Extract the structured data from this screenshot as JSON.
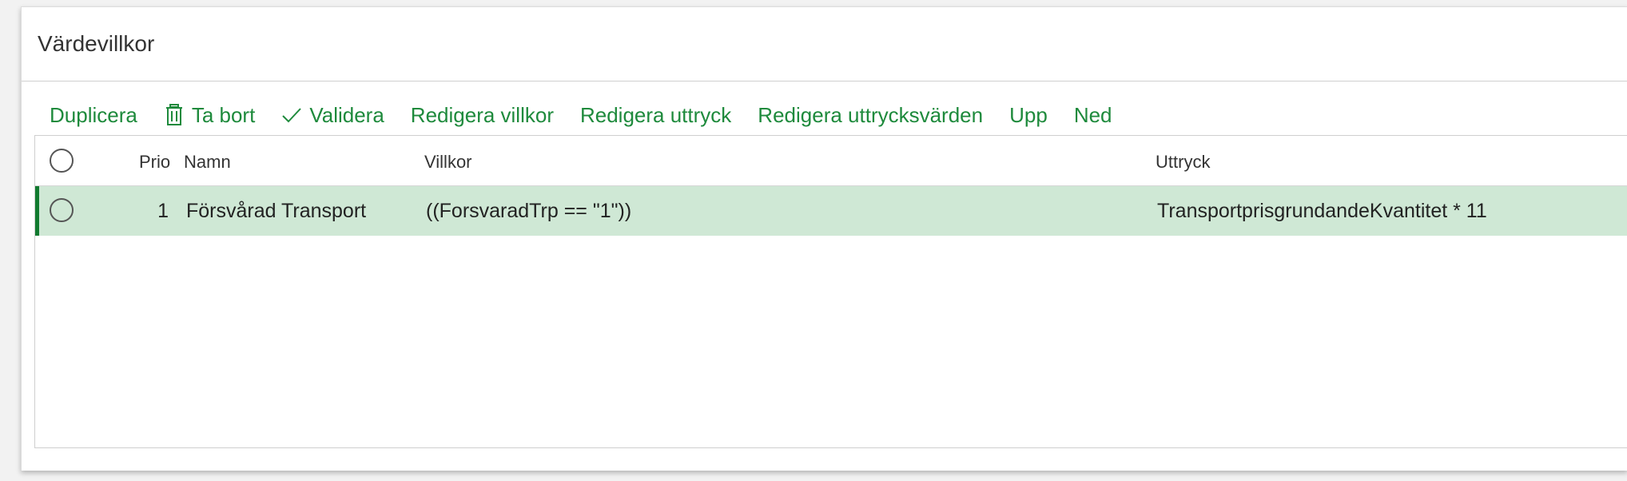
{
  "panel": {
    "title": "Värdevillkor"
  },
  "toolbar": {
    "duplicate": "Duplicera",
    "delete": "Ta bort",
    "validate": "Validera",
    "edit_conditions": "Redigera villkor",
    "edit_expression": "Redigera uttryck",
    "edit_expression_values": "Redigera uttrycksvärden",
    "up": "Upp",
    "down": "Ned",
    "delete_icon": "trash-icon",
    "validate_icon": "checkmark-icon"
  },
  "table": {
    "columns": {
      "prio": "Prio",
      "name": "Namn",
      "conditions": "Villkor",
      "expression": "Uttryck"
    },
    "rows": [
      {
        "prio": "1",
        "name": "Försvårad Transport",
        "conditions": "((ForsvaradTrp == \"1\"))",
        "expression": "TransportprisgrundandeKvantitet * 11",
        "selected": true
      }
    ]
  },
  "colors": {
    "accent": "#1e8a3c",
    "row_selected_bg": "#cfe8d5",
    "row_marker": "#117a2f"
  }
}
